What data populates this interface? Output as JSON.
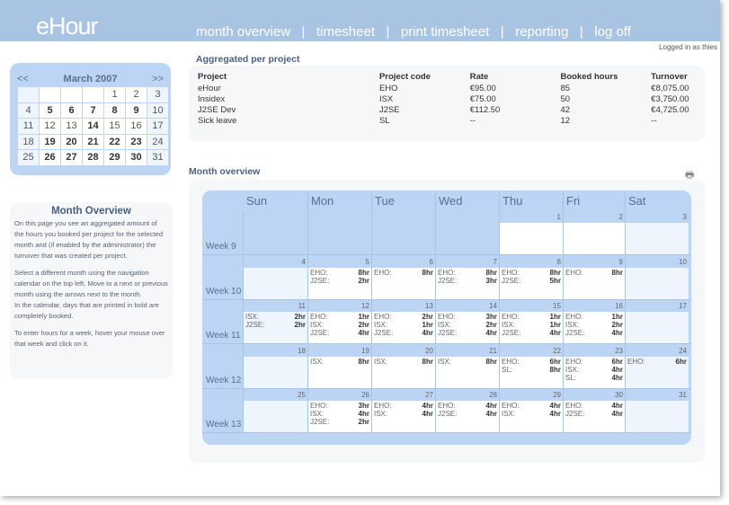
{
  "header": {
    "logo": "eHour",
    "nav": [
      "month overview",
      "timesheet",
      "print timesheet",
      "reporting",
      "log off"
    ],
    "logged_in": "Logged in as thies"
  },
  "minical": {
    "prev": "<<",
    "title": "March 2007",
    "next": ">>",
    "weeks": [
      [
        "",
        "",
        "",
        "",
        1,
        2,
        3
      ],
      [
        4,
        5,
        6,
        7,
        8,
        9,
        10
      ],
      [
        11,
        12,
        13,
        14,
        15,
        16,
        17
      ],
      [
        18,
        19,
        20,
        21,
        22,
        23,
        24
      ],
      [
        25,
        26,
        27,
        28,
        29,
        30,
        31
      ]
    ],
    "bold": [
      5,
      6,
      7,
      8,
      9,
      14,
      19,
      20,
      21,
      22,
      23,
      26,
      27,
      28,
      29,
      30
    ]
  },
  "help": {
    "title": "Month Overview",
    "paragraphs": [
      "On this page you see an aggregated amount of the hours you booked per project for the selected month and (if enabled by the administrator) the turnover that was created per project.",
      "Select a different month using the navigation calendar on the top left. Move to a next or previous month using the arrows next to the month.\nIn the calendar, days that are printed in bold are completely booked.",
      "To enter hours for a week, hover your mouse over that week and click on it."
    ]
  },
  "aggregated": {
    "title": "Aggregated per project",
    "columns": [
      "Project",
      "Project code",
      "Rate",
      "Booked hours",
      "Turnover"
    ],
    "rows": [
      [
        "eHour",
        "EHO",
        "€95.00",
        "85",
        "€8,075.00"
      ],
      [
        "Insidex",
        "ISX",
        "€75.00",
        "50",
        "€3,750.00"
      ],
      [
        "J2SE Dev",
        "J2SE",
        "€112.50",
        "42",
        "€4,725.00"
      ],
      [
        "Sick leave",
        "SL",
        "--",
        "12",
        "--"
      ]
    ]
  },
  "month": {
    "title": "Month overview",
    "print_icon": "printer-icon",
    "days": [
      "Sun",
      "Mon",
      "Tue",
      "Wed",
      "Thu",
      "Fri",
      "Sat"
    ],
    "weeks": [
      {
        "label": "Week 9",
        "days": [
          null,
          null,
          null,
          null,
          {
            "n": "1",
            "e": []
          },
          {
            "n": "2",
            "e": []
          },
          {
            "n": "3",
            "e": []
          }
        ]
      },
      {
        "label": "Week 10",
        "days": [
          {
            "n": "4",
            "e": []
          },
          {
            "n": "5",
            "e": [
              [
                "EHO:",
                "8hr"
              ],
              [
                "J2SE:",
                "2hr"
              ]
            ]
          },
          {
            "n": "6",
            "e": [
              [
                "EHO:",
                "8hr"
              ]
            ]
          },
          {
            "n": "7",
            "e": [
              [
                "EHO:",
                "8hr"
              ],
              [
                "J2SE:",
                "3hr"
              ]
            ]
          },
          {
            "n": "8",
            "e": [
              [
                "EHO:",
                "8hr"
              ],
              [
                "J2SE:",
                "5hr"
              ]
            ]
          },
          {
            "n": "9",
            "e": [
              [
                "EHO:",
                "8hr"
              ]
            ]
          },
          {
            "n": "10",
            "e": []
          }
        ]
      },
      {
        "label": "Week 11",
        "days": [
          {
            "n": "11",
            "e": [
              [
                "ISX:",
                "2hr"
              ],
              [
                "J2SE:",
                "2hr"
              ]
            ]
          },
          {
            "n": "12",
            "e": [
              [
                "EHO:",
                "1hr"
              ],
              [
                "ISX:",
                "2hr"
              ],
              [
                "J2SE:",
                "4hr"
              ]
            ]
          },
          {
            "n": "13",
            "e": [
              [
                "EHO:",
                "2hr"
              ],
              [
                "ISX:",
                "1hr"
              ],
              [
                "J2SE:",
                "4hr"
              ]
            ]
          },
          {
            "n": "14",
            "e": [
              [
                "EHO:",
                "3hr"
              ],
              [
                "ISX:",
                "2hr"
              ],
              [
                "J2SE:",
                "4hr"
              ]
            ]
          },
          {
            "n": "15",
            "e": [
              [
                "EHO:",
                "1hr"
              ],
              [
                "ISX:",
                "1hr"
              ],
              [
                "J2SE:",
                "4hr"
              ]
            ]
          },
          {
            "n": "16",
            "e": [
              [
                "EHO:",
                "1hr"
              ],
              [
                "ISX:",
                "2hr"
              ],
              [
                "J2SE:",
                "4hr"
              ]
            ]
          },
          {
            "n": "17",
            "e": []
          }
        ]
      },
      {
        "label": "Week 12",
        "days": [
          {
            "n": "18",
            "e": []
          },
          {
            "n": "19",
            "e": [
              [
                "ISX:",
                "8hr"
              ]
            ]
          },
          {
            "n": "20",
            "e": [
              [
                "ISX:",
                "8hr"
              ]
            ]
          },
          {
            "n": "21",
            "e": [
              [
                "ISX:",
                "8hr"
              ]
            ]
          },
          {
            "n": "22",
            "e": [
              [
                "EHO:",
                "6hr"
              ],
              [
                "SL:",
                "8hr"
              ]
            ]
          },
          {
            "n": "23",
            "e": [
              [
                "EHO:",
                "6hr"
              ],
              [
                "ISX:",
                "4hr"
              ],
              [
                "SL:",
                "4hr"
              ]
            ]
          },
          {
            "n": "24",
            "e": [
              [
                "EHO:",
                "6hr"
              ]
            ]
          }
        ]
      },
      {
        "label": "Week 13",
        "days": [
          {
            "n": "25",
            "e": []
          },
          {
            "n": "26",
            "e": [
              [
                "EHO:",
                "3hr"
              ],
              [
                "ISX:",
                "4hr"
              ],
              [
                "J2SE:",
                "2hr"
              ]
            ]
          },
          {
            "n": "27",
            "e": [
              [
                "EHO:",
                "4hr"
              ],
              [
                "ISX:",
                "4hr"
              ]
            ]
          },
          {
            "n": "28",
            "e": [
              [
                "EHO:",
                "4hr"
              ],
              [
                "J2SE:",
                "4hr"
              ]
            ]
          },
          {
            "n": "29",
            "e": [
              [
                "EHO:",
                "4hr"
              ],
              [
                "ISX:",
                "4hr"
              ]
            ]
          },
          {
            "n": "30",
            "e": [
              [
                "EHO:",
                "4hr"
              ],
              [
                "J2SE:",
                "4hr"
              ]
            ]
          },
          {
            "n": "31",
            "e": []
          }
        ]
      }
    ]
  }
}
